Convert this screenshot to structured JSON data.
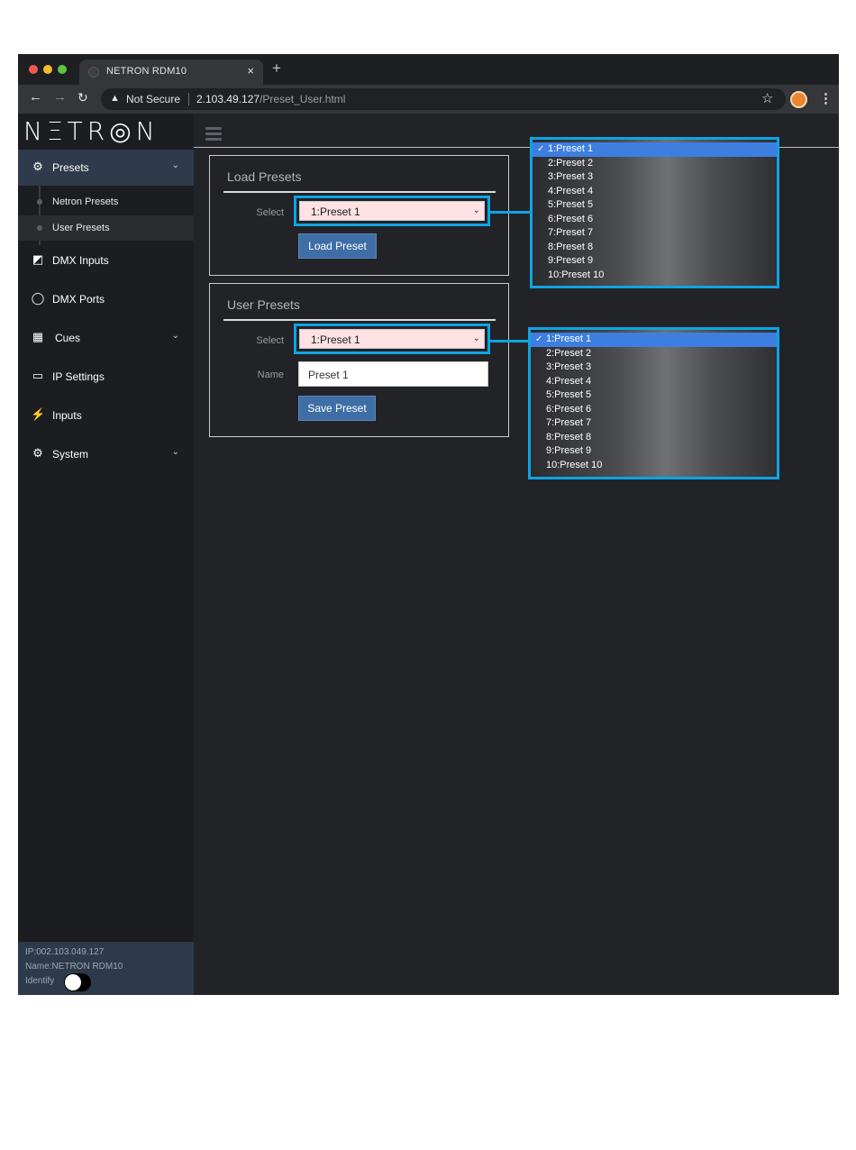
{
  "browser": {
    "tab_title": "NETRON RDM10",
    "tab_close": "×",
    "new_tab": "+",
    "security_label": "Not Secure",
    "url_host": "2.103.49.127",
    "url_path": "/Preset_User.html"
  },
  "sidebar": {
    "logo": "NΞTR◎N",
    "items": [
      {
        "label": "Presets",
        "icon": "gear-icon",
        "glyph": "⚙",
        "has_submenu": true
      },
      {
        "label": "DMX Inputs",
        "icon": "edit-icon",
        "glyph": "◩",
        "has_submenu": false
      },
      {
        "label": "DMX Ports",
        "icon": "circle-icon",
        "glyph": "◯",
        "has_submenu": false
      },
      {
        "label": "Cues",
        "icon": "film-icon",
        "glyph": "▦",
        "has_submenu": true
      },
      {
        "label": "IP Settings",
        "icon": "laptop-icon",
        "glyph": "▭",
        "has_submenu": false
      },
      {
        "label": "Inputs",
        "icon": "plug-icon",
        "glyph": "⚡",
        "has_submenu": false
      },
      {
        "label": "System",
        "icon": "gear-icon",
        "glyph": "⚙",
        "has_submenu": true
      }
    ],
    "submenu": [
      {
        "label": "Netron Presets"
      },
      {
        "label": "User Presets"
      }
    ],
    "footer": {
      "ip": "IP:002.103.049.127",
      "name": "Name:NETRON RDM10",
      "identify": "Identify",
      "identify_on": false
    }
  },
  "load_panel": {
    "title": "Load Presets",
    "select_label": "Select",
    "select_value": "1:Preset 1",
    "button": "Load Preset"
  },
  "user_panel": {
    "title": "User Presets",
    "select_label": "Select",
    "select_value": "1:Preset 1",
    "name_label": "Name",
    "name_value": "Preset 1",
    "button": "Save Preset"
  },
  "dropdown_options": [
    "1:Preset 1",
    "2:Preset 2",
    "3:Preset 3",
    "4:Preset 4",
    "5:Preset 5",
    "6:Preset 6",
    "7:Preset 7",
    "8:Preset 8",
    "9:Preset 9",
    "10:Preset 10"
  ],
  "colors": {
    "callout": "#0fa3e4",
    "button": "#3f6ea6",
    "select_bg": "#fde1e3",
    "highlight": "#3d7fe0",
    "sidebar_active": "#2f3b4c"
  }
}
